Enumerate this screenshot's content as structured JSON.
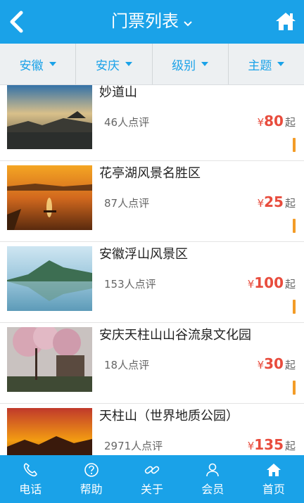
{
  "header": {
    "title": "门票列表",
    "colors": {
      "primary": "#1aa2e8"
    }
  },
  "filters": [
    {
      "label": "安徽"
    },
    {
      "label": "安庆"
    },
    {
      "label": "级别"
    },
    {
      "label": "主题"
    }
  ],
  "items": [
    {
      "name": "妙道山",
      "reviews": "46人点评",
      "currency": "¥",
      "price": "80",
      "suffix": "起"
    },
    {
      "name": "花亭湖风景名胜区",
      "reviews": "87人点评",
      "currency": "¥",
      "price": "25",
      "suffix": "起"
    },
    {
      "name": "安徽浮山风景区",
      "reviews": "153人点评",
      "currency": "¥",
      "price": "100",
      "suffix": "起"
    },
    {
      "name": "安庆天柱山山谷流泉文化园",
      "reviews": "18人点评",
      "currency": "¥",
      "price": "30",
      "suffix": "起"
    },
    {
      "name": "天柱山（世界地质公园）",
      "reviews": "2971人点评",
      "currency": "¥",
      "price": "135",
      "suffix": "起"
    }
  ],
  "tabbar": [
    {
      "label": "电话",
      "icon": "phone-icon"
    },
    {
      "label": "帮助",
      "icon": "help-icon"
    },
    {
      "label": "关于",
      "icon": "link-icon"
    },
    {
      "label": "会员",
      "icon": "user-icon"
    },
    {
      "label": "首页",
      "icon": "home-icon"
    }
  ]
}
